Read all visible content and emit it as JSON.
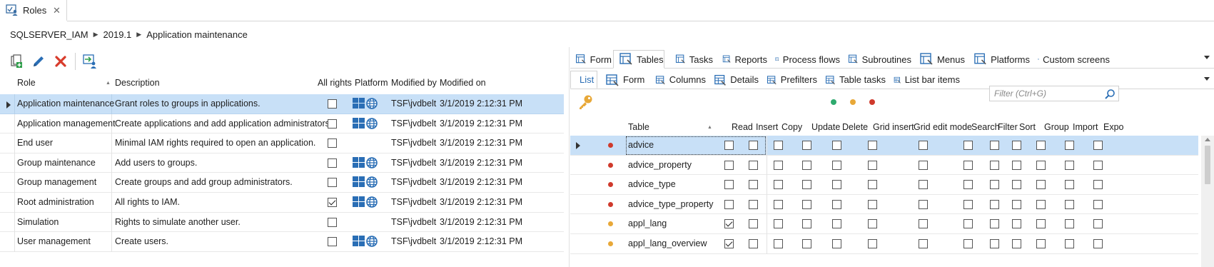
{
  "document_tab": {
    "label": "Roles",
    "close_glyph": "✕",
    "icon": "roles-icon"
  },
  "breadcrumb": [
    "SQLSERVER_IAM",
    "2019.1",
    "Application maintenance"
  ],
  "left": {
    "toolbar": {
      "icons": [
        "add-icon",
        "edit-icon",
        "delete-icon",
        "import-icon"
      ]
    },
    "filter_placeholder": "Filter (Ctrl+G)",
    "columns": [
      "Role",
      "Description",
      "All rights",
      "Platform",
      "Modified by",
      "Modified on"
    ],
    "rows": [
      {
        "role": "Application maintenance",
        "description": "Grant roles to groups in applications.",
        "all_rights": false,
        "platform": true,
        "modified_by": "TSF\\jvdbelt",
        "modified_on": "3/1/2019 2:12:31 PM",
        "selected": true
      },
      {
        "role": "Application management",
        "description": "Create applications and add application administrators.",
        "all_rights": false,
        "platform": true,
        "modified_by": "TSF\\jvdbelt",
        "modified_on": "3/1/2019 2:12:31 PM",
        "selected": false
      },
      {
        "role": "End user",
        "description": "Minimal IAM rights required to open an application.",
        "all_rights": false,
        "platform": false,
        "modified_by": "TSF\\jvdbelt",
        "modified_on": "3/1/2019 2:12:31 PM",
        "selected": false
      },
      {
        "role": "Group maintenance",
        "description": "Add users to groups.",
        "all_rights": false,
        "platform": true,
        "modified_by": "TSF\\jvdbelt",
        "modified_on": "3/1/2019 2:12:31 PM",
        "selected": false
      },
      {
        "role": "Group management",
        "description": "Create groups and add group administrators.",
        "all_rights": false,
        "platform": true,
        "modified_by": "TSF\\jvdbelt",
        "modified_on": "3/1/2019 2:12:31 PM",
        "selected": false
      },
      {
        "role": "Root administration",
        "description": "All rights to IAM.",
        "all_rights": true,
        "platform": true,
        "modified_by": "TSF\\jvdbelt",
        "modified_on": "3/1/2019 2:12:31 PM",
        "selected": false
      },
      {
        "role": "Simulation",
        "description": "Rights to simulate another user.",
        "all_rights": false,
        "platform": false,
        "modified_by": "TSF\\jvdbelt",
        "modified_on": "3/1/2019 2:12:31 PM",
        "selected": false
      },
      {
        "role": "User management",
        "description": "Create users.",
        "all_rights": false,
        "platform": true,
        "modified_by": "TSF\\jvdbelt",
        "modified_on": "3/1/2019 2:12:31 PM",
        "selected": false
      }
    ]
  },
  "right": {
    "tabs": [
      {
        "label": "Form",
        "icon": "form-icon",
        "active": false
      },
      {
        "label": "Tables",
        "icon": "tables-icon",
        "active": true
      },
      {
        "label": "Tasks",
        "icon": "tasks-icon",
        "active": false
      },
      {
        "label": "Reports",
        "icon": "reports-icon",
        "active": false
      },
      {
        "label": "Process flows",
        "icon": "process-flows-icon",
        "active": false
      },
      {
        "label": "Subroutines",
        "icon": "subroutines-icon",
        "active": false
      },
      {
        "label": "Menus",
        "icon": "menus-icon",
        "active": false
      },
      {
        "label": "Platforms",
        "icon": "platforms-icon",
        "active": false
      },
      {
        "label": "Custom screens",
        "icon": "custom-screens-icon",
        "active": false
      }
    ],
    "subtabs": [
      {
        "label": "List",
        "icon": "",
        "active": true
      },
      {
        "label": "Form",
        "icon": "form-icon",
        "active": false
      },
      {
        "label": "Columns",
        "icon": "columns-icon",
        "active": false
      },
      {
        "label": "Details",
        "icon": "details-icon",
        "active": false
      },
      {
        "label": "Prefilters",
        "icon": "prefilters-icon",
        "active": false
      },
      {
        "label": "Table tasks",
        "icon": "table-tasks-icon",
        "active": false
      },
      {
        "label": "List bar items",
        "icon": "list-bar-items-icon",
        "active": false
      }
    ],
    "filter_placeholder": "Filter (Ctrl+G)",
    "legend_colors": [
      "#2eaa6e",
      "#e8a838",
      "#cf3a2c"
    ],
    "columns": [
      "Table",
      "Read",
      "Insert",
      "Copy",
      "Update",
      "Delete",
      "Grid insert",
      "Grid edit mode",
      "Search",
      "Filter",
      "Sort",
      "Group",
      "Import",
      "Expo"
    ],
    "rows": [
      {
        "table": "advice",
        "status_color": "#cf3a2c",
        "read": false,
        "selected": true
      },
      {
        "table": "advice_property",
        "status_color": "#cf3a2c",
        "read": false,
        "selected": false
      },
      {
        "table": "advice_type",
        "status_color": "#cf3a2c",
        "read": false,
        "selected": false
      },
      {
        "table": "advice_type_property",
        "status_color": "#cf3a2c",
        "read": false,
        "selected": false
      },
      {
        "table": "appl_lang",
        "status_color": "#e8a838",
        "read": true,
        "selected": false
      },
      {
        "table": "appl_lang_overview",
        "status_color": "#e8a838",
        "read": true,
        "selected": false
      }
    ]
  }
}
